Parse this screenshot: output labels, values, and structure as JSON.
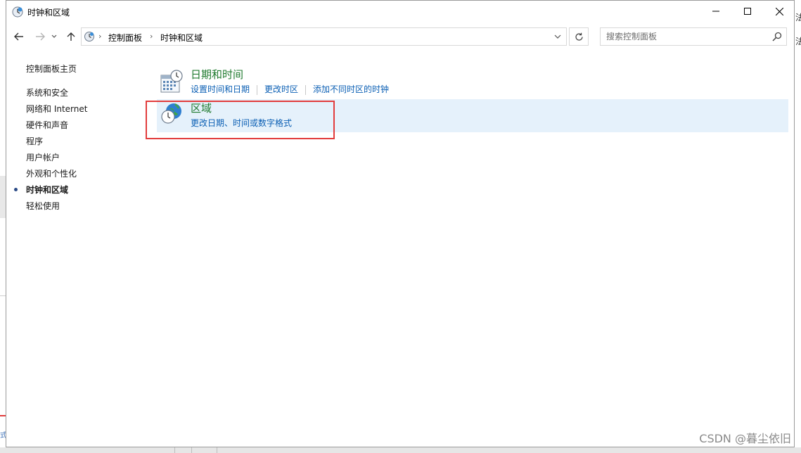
{
  "window": {
    "title": "时钟和区域"
  },
  "address_bar": {
    "crumbs": [
      "控制面板",
      "时钟和区域"
    ]
  },
  "search": {
    "placeholder": "搜索控制面板"
  },
  "left_nav": {
    "home": "控制面板主页",
    "items": [
      {
        "label": "系统和安全",
        "active": false
      },
      {
        "label": "网络和 Internet",
        "active": false
      },
      {
        "label": "硬件和声音",
        "active": false
      },
      {
        "label": "程序",
        "active": false
      },
      {
        "label": "用户帐户",
        "active": false
      },
      {
        "label": "外观和个性化",
        "active": false
      },
      {
        "label": "时钟和区域",
        "active": true
      },
      {
        "label": "轻松使用",
        "active": false
      }
    ]
  },
  "categories": [
    {
      "title": "日期和时间",
      "icon": "calendar-clock-icon",
      "links": [
        "设置时间和日期",
        "更改时区",
        "添加不同时区的时钟"
      ]
    },
    {
      "title": "区域",
      "icon": "globe-clock-icon",
      "links": [
        "更改日期、时间或数字格式"
      ],
      "highlighted": true
    }
  ],
  "background": {
    "right_chars": [
      "法",
      "法"
    ],
    "left_text": "式"
  },
  "watermark": "CSDN @暮尘依旧",
  "colors": {
    "link": "#0b5fb4",
    "category_title": "#1f7a2e",
    "highlight": "#e5f1fb",
    "annotation_red": "#e23c3c"
  }
}
